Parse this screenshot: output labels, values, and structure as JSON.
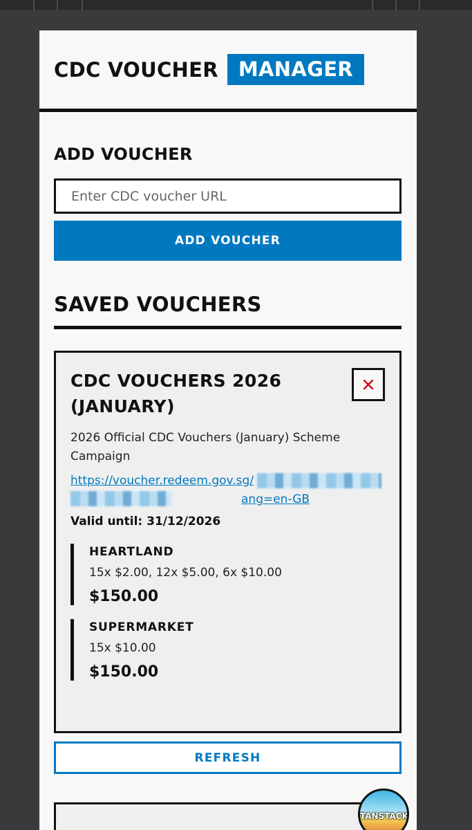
{
  "app": {
    "brand_part1": "CDC VOUCHER",
    "brand_part2": "MANAGER"
  },
  "add_section": {
    "heading": "ADD VOUCHER",
    "input_placeholder": "Enter CDC voucher URL",
    "input_value": "",
    "button_label": "ADD VOUCHER"
  },
  "saved_section": {
    "heading": "SAVED VOUCHERS"
  },
  "vouchers": [
    {
      "title": "CDC VOUCHERS 2026 (JANUARY)",
      "delete_symbol": "×",
      "description": "2026 Official CDC Vouchers (January) Scheme Campaign",
      "link_start": "https://voucher.redeem.gov.sg/",
      "link_end": "ang=en-GB",
      "valid_until": "Valid until: 31/12/2026",
      "categories": [
        {
          "name": "HEARTLAND",
          "detail": "15x $2.00, 12x $5.00, 6x $10.00",
          "amount": "$150.00"
        },
        {
          "name": "SUPERMARKET",
          "detail": "15x $10.00",
          "amount": "$150.00"
        }
      ],
      "refresh_label": "REFRESH"
    }
  ],
  "devtools": {
    "label": "TANSTACK"
  },
  "colors": {
    "accent": "#0079c1",
    "delete": "#d0021b",
    "outer_bg": "#3a3a3d",
    "panel_bg": "#f8f8f8",
    "card_bg": "#efefef"
  }
}
